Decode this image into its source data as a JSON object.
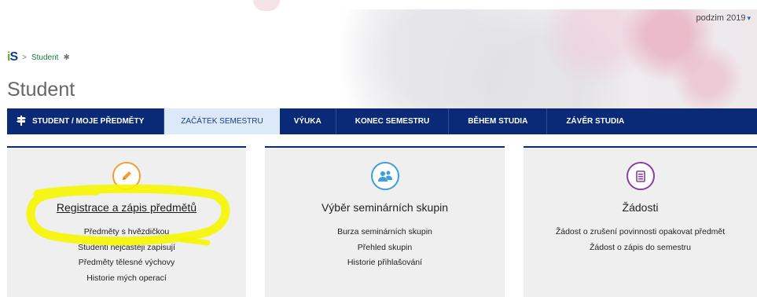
{
  "header": {
    "semester_label": "podzim 2019",
    "breadcrumb": {
      "logo_text": "iS",
      "separator": ">",
      "current": "Student"
    },
    "page_title": "Student"
  },
  "nav": {
    "items": [
      {
        "label": "STUDENT / MOJE PŘEDMĚTY",
        "icon": "signpost-icon"
      },
      {
        "label": "ZAČÁTEK SEMESTRU",
        "active": true
      },
      {
        "label": "VÝUKA"
      },
      {
        "label": "KONEC SEMESTRU"
      },
      {
        "label": "BĚHEM STUDIA"
      },
      {
        "label": "ZÁVĚR STUDIA"
      }
    ]
  },
  "cards": [
    {
      "icon": "pencil-icon",
      "title": "Registrace a zápis předmětů",
      "links": [
        "Předměty s hvězdičkou",
        "Studenti nejčastěji zapisují",
        "Předměty tělesné výchovy",
        "Historie mých operací"
      ]
    },
    {
      "icon": "people-icon",
      "title": "Výběr seminárních skupin",
      "links": [
        "Burza seminárních skupin",
        "Přehled skupin",
        "Historie přihlašování"
      ]
    },
    {
      "icon": "document-icon",
      "title": "Žádosti",
      "links": [
        "Žádost o zrušení povinnosti opakovat předmět",
        "Žádost o zápis do semestru"
      ]
    }
  ],
  "colors": {
    "nav_bg": "#0a2a78",
    "nav_active_bg": "#dce9f8",
    "highlight": "#f5f500"
  }
}
